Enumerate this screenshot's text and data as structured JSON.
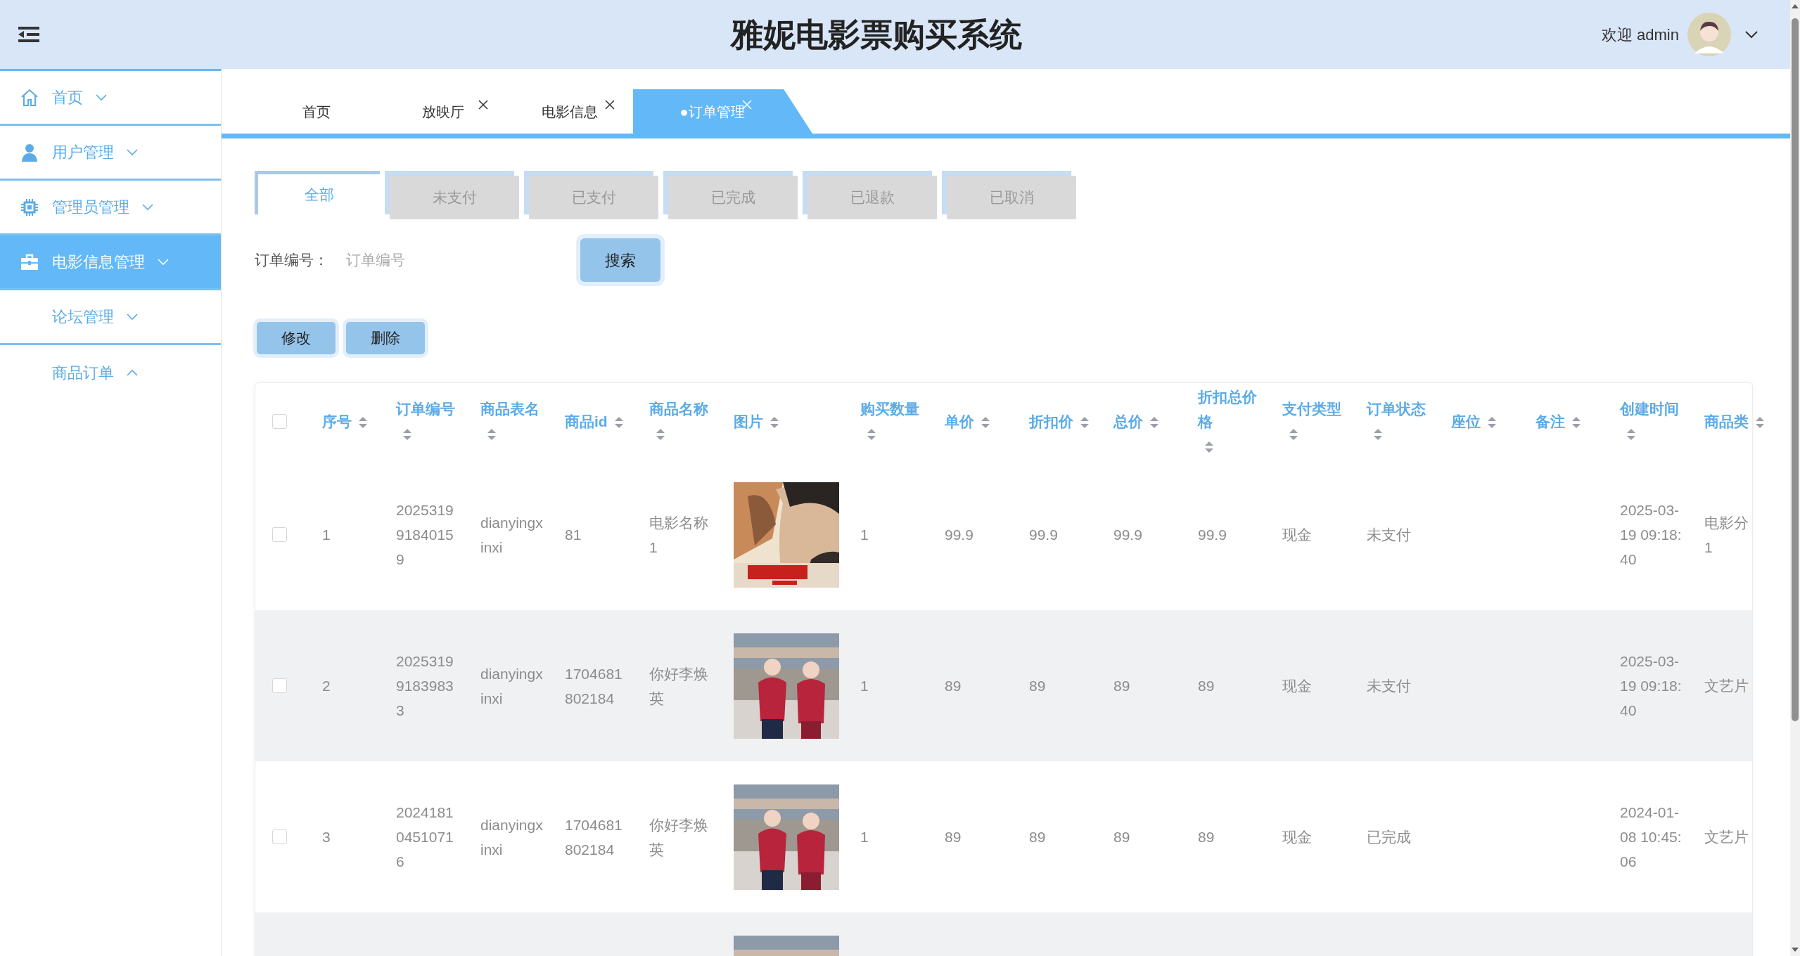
{
  "header": {
    "title": "雅妮电影票购买系统",
    "welcome": "欢迎 admin"
  },
  "sidebar": {
    "items": [
      {
        "label": "首页",
        "expanded": false,
        "selected": false
      },
      {
        "label": "用户管理",
        "expanded": false,
        "selected": false
      },
      {
        "label": "管理员管理",
        "expanded": false,
        "selected": false
      },
      {
        "label": "电影信息管理",
        "expanded": false,
        "selected": true
      },
      {
        "label": "论坛管理",
        "expanded": false,
        "selected": false
      },
      {
        "label": "商品订单",
        "expanded": true,
        "selected": false
      }
    ]
  },
  "tabs": [
    {
      "label": "首页",
      "closable": false,
      "selected": false
    },
    {
      "label": "放映厅",
      "closable": true,
      "selected": false
    },
    {
      "label": "电影信息",
      "closable": true,
      "selected": false
    },
    {
      "label": "●订单管理",
      "closable": true,
      "selected": true
    }
  ],
  "filters": [
    {
      "label": "全部",
      "selected": true
    },
    {
      "label": "未支付",
      "selected": false
    },
    {
      "label": "已支付",
      "selected": false
    },
    {
      "label": "已完成",
      "selected": false
    },
    {
      "label": "已退款",
      "selected": false
    },
    {
      "label": "已取消",
      "selected": false
    }
  ],
  "search": {
    "label": "订单编号：",
    "placeholder": "订单编号",
    "button": "搜索"
  },
  "actions": [
    "修改",
    "删除"
  ],
  "table": {
    "header_checkbox": {
      "checked": false
    },
    "columns": [
      {
        "label": "序号",
        "kind": "text"
      },
      {
        "label": "订单编号",
        "kind": "text"
      },
      {
        "label": "商品表名",
        "kind": "text"
      },
      {
        "label": "商品id",
        "kind": "text"
      },
      {
        "label": "商品名称",
        "kind": "text"
      },
      {
        "label": "图片",
        "kind": "picture"
      },
      {
        "label": "购买数量",
        "kind": "text"
      },
      {
        "label": "单价",
        "kind": "text"
      },
      {
        "label": "折扣价",
        "kind": "text"
      },
      {
        "label": "总价",
        "kind": "text"
      },
      {
        "label": "折扣总价格",
        "kind": "text"
      },
      {
        "label": "支付类型",
        "kind": "text"
      },
      {
        "label": "订单状态",
        "kind": "text"
      },
      {
        "label": "座位",
        "kind": "text"
      },
      {
        "label": "备注",
        "kind": "text"
      },
      {
        "label": "创建时间",
        "kind": "text"
      },
      {
        "label": "商品类",
        "kind": "text"
      }
    ],
    "rows": [
      {
        "checked": false,
        "no": "1",
        "order_no": "202531991840159",
        "table_name": "dianyingxinxi",
        "product_id": "81",
        "product_name": "电影名称1",
        "image": {
          "kind": "picture"
        },
        "quantity": "1",
        "price": "99.9",
        "discount_price": "99.9",
        "total": "99.9",
        "discount_total": "99.9",
        "payment": "现金",
        "status": "未支付",
        "created": "2025-03-19 09:18:40",
        "category": "电影分1"
      },
      {
        "checked": false,
        "no": "2",
        "order_no": "202531991839833",
        "table_name": "dianyingxinxi",
        "product_id": "1704681802184",
        "product_name": "你好李焕英",
        "image": {
          "kind": "picture"
        },
        "quantity": "1",
        "price": "89",
        "discount_price": "89",
        "total": "89",
        "discount_total": "89",
        "payment": "现金",
        "status": "未支付",
        "created": "2025-03-19 09:18:40",
        "category": "文艺片"
      },
      {
        "checked": false,
        "no": "3",
        "order_no": "202418104510716",
        "table_name": "dianyingxinxi",
        "product_id": "1704681802184",
        "product_name": "你好李焕英",
        "image": {
          "kind": "picture"
        },
        "quantity": "1",
        "price": "89",
        "discount_price": "89",
        "total": "89",
        "discount_total": "89",
        "payment": "现金",
        "status": "已完成",
        "created": "2024-01-08 10:45:06",
        "category": "文艺片"
      },
      {
        "image": {
          "kind": "picture"
        }
      }
    ]
  }
}
